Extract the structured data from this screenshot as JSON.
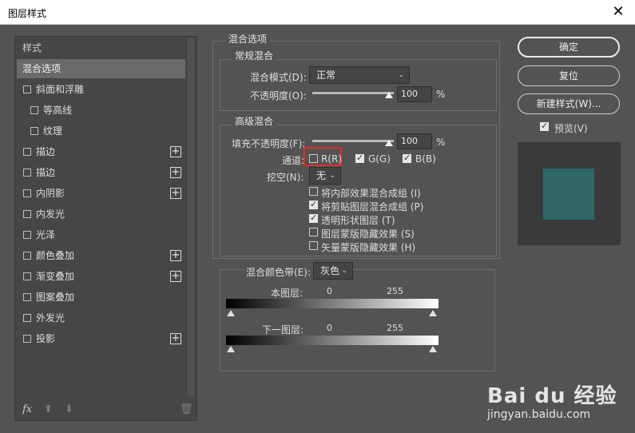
{
  "window": {
    "title": "图层样式",
    "close_glyph": "✕"
  },
  "styles": {
    "header": "样式",
    "items": [
      {
        "label": "混合选项",
        "selected": true,
        "checkbox": false,
        "plus": false,
        "indent": 0
      },
      {
        "label": "斜面和浮雕",
        "checkbox": true,
        "plus": false,
        "indent": 0
      },
      {
        "label": "等高线",
        "checkbox": true,
        "plus": false,
        "indent": 1
      },
      {
        "label": "纹理",
        "checkbox": true,
        "plus": false,
        "indent": 1
      },
      {
        "label": "描边",
        "checkbox": true,
        "plus": true,
        "indent": 0
      },
      {
        "label": "描边",
        "checkbox": true,
        "plus": true,
        "indent": 0
      },
      {
        "label": "内阴影",
        "checkbox": true,
        "plus": true,
        "indent": 0
      },
      {
        "label": "内发光",
        "checkbox": true,
        "plus": false,
        "indent": 0
      },
      {
        "label": "光泽",
        "checkbox": true,
        "plus": false,
        "indent": 0
      },
      {
        "label": "颜色叠加",
        "checkbox": true,
        "plus": true,
        "indent": 0
      },
      {
        "label": "渐变叠加",
        "checkbox": true,
        "plus": true,
        "indent": 0
      },
      {
        "label": "图案叠加",
        "checkbox": true,
        "plus": false,
        "indent": 0
      },
      {
        "label": "外发光",
        "checkbox": true,
        "plus": false,
        "indent": 0
      },
      {
        "label": "投影",
        "checkbox": true,
        "plus": true,
        "indent": 0
      }
    ],
    "bottom": {
      "fx": "fx",
      "up": "⬆",
      "down": "⬇",
      "trash": "🗑"
    }
  },
  "blend_options": {
    "title": "混合选项",
    "general": {
      "title": "常规混合",
      "mode_label": "混合模式(D):",
      "mode_value": "正常",
      "opacity_label": "不透明度(O):",
      "opacity_value": "100",
      "percent": "%"
    },
    "advanced": {
      "title": "高级混合",
      "fill_label": "填充不透明度(F):",
      "fill_value": "100",
      "percent": "%",
      "channels_label": "通道:",
      "channels": [
        {
          "label": "R(R)",
          "checked": false
        },
        {
          "label": "G(G)",
          "checked": true
        },
        {
          "label": "B(B)",
          "checked": true
        }
      ],
      "knockout_label": "挖空(N):",
      "knockout_value": "无",
      "options": [
        {
          "label": "将内部效果混合成组 (I)",
          "checked": false
        },
        {
          "label": "将剪贴图层混合成组 (P)",
          "checked": true
        },
        {
          "label": "透明形状图层 (T)",
          "checked": true
        },
        {
          "label": "图层蒙版隐藏效果 (S)",
          "checked": false
        },
        {
          "label": "矢量蒙版隐藏效果 (H)",
          "checked": false
        }
      ]
    },
    "blend_if": {
      "label": "混合颜色带(E):",
      "value": "灰色",
      "this_layer": {
        "label": "本图层:",
        "min": "0",
        "max": "255"
      },
      "underlying": {
        "label": "下一图层:",
        "min": "0",
        "max": "255"
      }
    }
  },
  "actions": {
    "ok": "确定",
    "reset": "复位",
    "new_style": "新建样式(W)...",
    "preview_label": "预览(V)",
    "preview_checked": true,
    "preview_color": "#2f6668"
  },
  "watermark": {
    "brand": "Bai du 经验",
    "site": "jingyan.baidu.com"
  }
}
